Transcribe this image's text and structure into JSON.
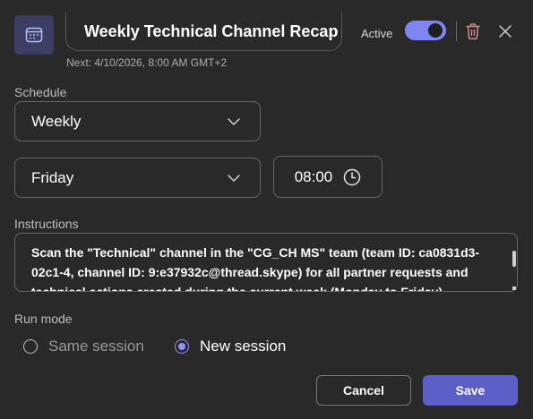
{
  "header": {
    "title": "Weekly Technical Channel Recap",
    "next_run": "Next: 4/10/2026, 8:00 AM GMT+2",
    "active_label": "Active",
    "active": true,
    "icon": "calendar-icon"
  },
  "schedule": {
    "label": "Schedule",
    "frequency": "Weekly",
    "day": "Friday",
    "time": "08:00"
  },
  "instructions": {
    "label": "Instructions",
    "text": "Scan the \"Technical\" channel in the \"CG_CH MS\" team (team ID: ca0831d3-02c1-4, channel ID: 9:e37932c@thread.skype) for all partner requests and technical actions created during the current week (Monday to Friday)."
  },
  "run_mode": {
    "label": "Run mode",
    "options": [
      "Same session",
      "New session"
    ],
    "selected": "New session"
  },
  "buttons": {
    "cancel": "Cancel",
    "save": "Save"
  },
  "colors": {
    "background": "#292929",
    "accent": "#7f85f5",
    "primary_button": "#5b5fc7"
  }
}
